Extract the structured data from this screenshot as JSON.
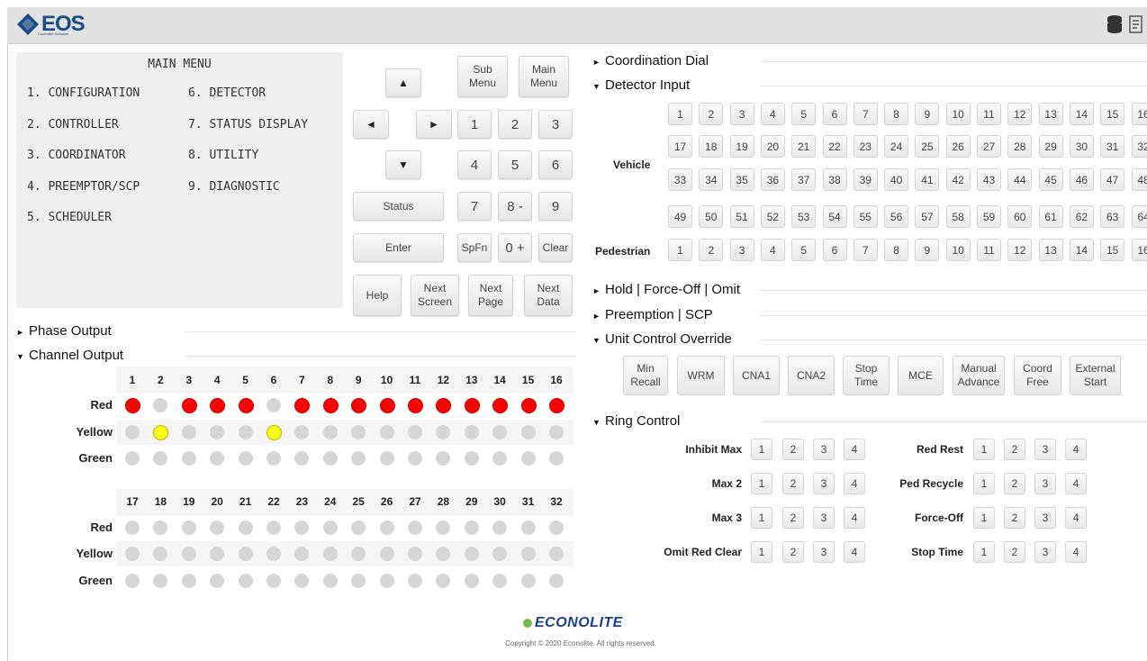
{
  "app": {
    "logo_text": "EOS",
    "logo_sub": "Controller Software",
    "brand_color": "#1a4b86"
  },
  "main_menu": {
    "title": "MAIN MENU",
    "items": [
      {
        "label": "1. CONFIGURATION"
      },
      {
        "label": "2. CONTROLLER"
      },
      {
        "label": "3. COORDINATOR"
      },
      {
        "label": "4. PREEMPTOR/SCP"
      },
      {
        "label": "5. SCHEDULER"
      },
      {
        "label": "6. DETECTOR"
      },
      {
        "label": "7. STATUS DISPLAY"
      },
      {
        "label": "8. UTILITY"
      },
      {
        "label": "9. DIAGNOSTIC"
      }
    ]
  },
  "keypad": {
    "up": "▲",
    "left": "◄",
    "right": "►",
    "down": "▼",
    "sub_menu": "Sub Menu",
    "main_menu": "Main Menu",
    "status": "Status",
    "enter": "Enter",
    "k1": "1",
    "k2": "2",
    "k3": "3",
    "k4": "4",
    "k5": "5",
    "k6": "6",
    "k7": "7",
    "k8": "8 -",
    "k9": "9",
    "spfn": "SpFn",
    "k0": "0 +",
    "clear": "Clear",
    "help": "Help",
    "next_screen": "Next Screen",
    "next_page": "Next Page",
    "next_data": "Next Data"
  },
  "sections": {
    "phase_output": "Phase Output",
    "channel_output": "Channel Output",
    "coordination_dial": "Coordination Dial",
    "detector_input": "Detector Input",
    "hold_force_omit": "Hold | Force-Off | Omit",
    "preemption_scp": "Preemption | SCP",
    "unit_control_override": "Unit Control Override",
    "ring_control": "Ring Control"
  },
  "channel_output": {
    "row_labels": {
      "red": "Red",
      "yellow": "Yellow",
      "green": "Green"
    },
    "colors": {
      "red": "#ff0000",
      "yellow": "#ffff1a",
      "off": "#d6d6d6"
    },
    "block1": {
      "channels": [
        "1",
        "2",
        "3",
        "4",
        "5",
        "6",
        "7",
        "8",
        "9",
        "10",
        "11",
        "12",
        "13",
        "14",
        "15",
        "16"
      ],
      "red": [
        true,
        false,
        true,
        true,
        true,
        false,
        true,
        true,
        true,
        true,
        true,
        true,
        true,
        true,
        true,
        true
      ],
      "yellow": [
        false,
        true,
        false,
        false,
        false,
        true,
        false,
        false,
        false,
        false,
        false,
        false,
        false,
        false,
        false,
        false
      ],
      "green": [
        false,
        false,
        false,
        false,
        false,
        false,
        false,
        false,
        false,
        false,
        false,
        false,
        false,
        false,
        false,
        false
      ]
    },
    "block2": {
      "channels": [
        "17",
        "18",
        "19",
        "20",
        "21",
        "22",
        "23",
        "24",
        "25",
        "26",
        "27",
        "28",
        "29",
        "30",
        "31",
        "32"
      ],
      "red": [
        false,
        false,
        false,
        false,
        false,
        false,
        false,
        false,
        false,
        false,
        false,
        false,
        false,
        false,
        false,
        false
      ],
      "yellow": [
        false,
        false,
        false,
        false,
        false,
        false,
        false,
        false,
        false,
        false,
        false,
        false,
        false,
        false,
        false,
        false
      ],
      "green": [
        false,
        false,
        false,
        false,
        false,
        false,
        false,
        false,
        false,
        false,
        false,
        false,
        false,
        false,
        false,
        false
      ]
    }
  },
  "detector_input": {
    "vehicle_label": "Vehicle",
    "pedestrian_label": "Pedestrian",
    "vehicle_rows": [
      [
        "1",
        "2",
        "3",
        "4",
        "5",
        "6",
        "7",
        "8",
        "9",
        "10",
        "11",
        "12",
        "13",
        "14",
        "15",
        "16"
      ],
      [
        "17",
        "18",
        "19",
        "20",
        "21",
        "22",
        "23",
        "24",
        "25",
        "26",
        "27",
        "28",
        "29",
        "30",
        "31",
        "32"
      ],
      [
        "33",
        "34",
        "35",
        "36",
        "37",
        "38",
        "39",
        "40",
        "41",
        "42",
        "43",
        "44",
        "45",
        "46",
        "47",
        "48"
      ],
      [
        "49",
        "50",
        "51",
        "52",
        "53",
        "54",
        "55",
        "56",
        "57",
        "58",
        "59",
        "60",
        "61",
        "62",
        "63",
        "64"
      ]
    ],
    "pedestrian_row": [
      "1",
      "2",
      "3",
      "4",
      "5",
      "6",
      "7",
      "8",
      "9",
      "10",
      "11",
      "12",
      "13",
      "14",
      "15",
      "16"
    ]
  },
  "unit_control_override": {
    "buttons": [
      "Min Recall",
      "WRM",
      "CNA1",
      "CNA2",
      "Stop Time",
      "MCE",
      "Manual Advance",
      "Coord Free",
      "External Start"
    ]
  },
  "ring_control": {
    "left": [
      "Inhibit Max",
      "Max 2",
      "Max 3",
      "Omit Red Clear"
    ],
    "right": [
      "Red Rest",
      "Ped Recycle",
      "Force-Off",
      "Stop Time"
    ],
    "rings": [
      "1",
      "2",
      "3",
      "4"
    ]
  },
  "footer": {
    "brand": "ECONOLITE",
    "copyright": "Copyright © 2020 Econolite. All rights reserved."
  }
}
